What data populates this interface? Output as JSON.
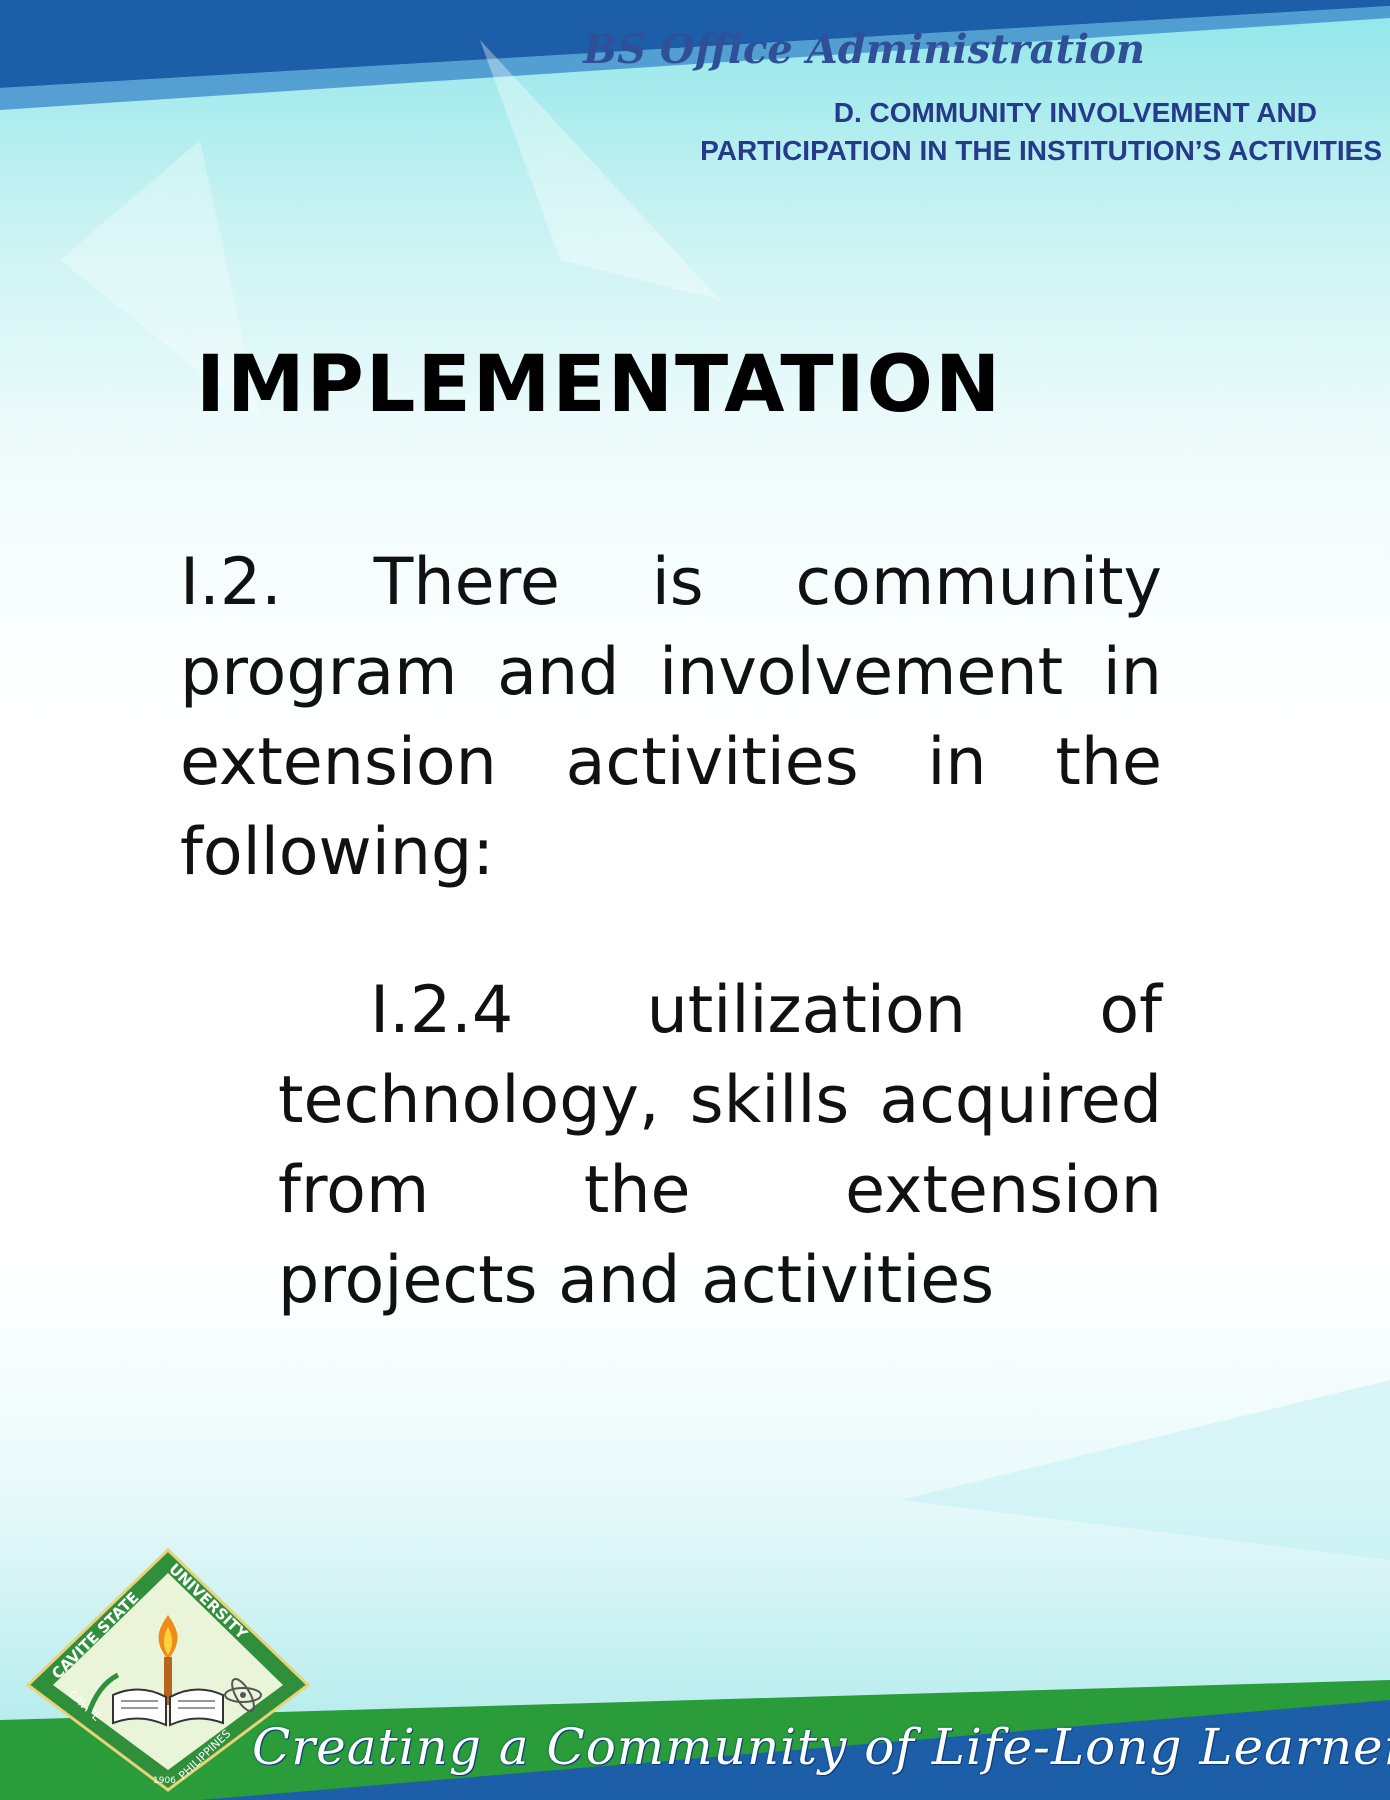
{
  "header": {
    "program_title": "BS Office Administration",
    "section_line1": "D. COMMUNITY INVOLVEMENT AND",
    "section_line2": "PARTICIPATION IN THE INSTITUTION’S ACTIVITIES"
  },
  "main": {
    "title": "IMPLEMENTATION",
    "paragraph": "I.2. There is community program and involvement in extension activities in the following:",
    "sub_item": "I.2.4 utilization of technology, skills acquired from the extension projects and activities"
  },
  "footer": {
    "tagline": "Creating a Community of Life-Long Learners",
    "logo_text": [
      "CAVITE STATE",
      "UNIVERSITY",
      "CAVITE",
      "PHILIPPINES",
      "1906"
    ]
  },
  "colors": {
    "header_blue": "#2f4f97",
    "section_navy": "#263a8a",
    "band_blue": "#1d5ea8",
    "band_green": "#2a9c3a"
  },
  "icons": [
    "university-seal-icon"
  ]
}
